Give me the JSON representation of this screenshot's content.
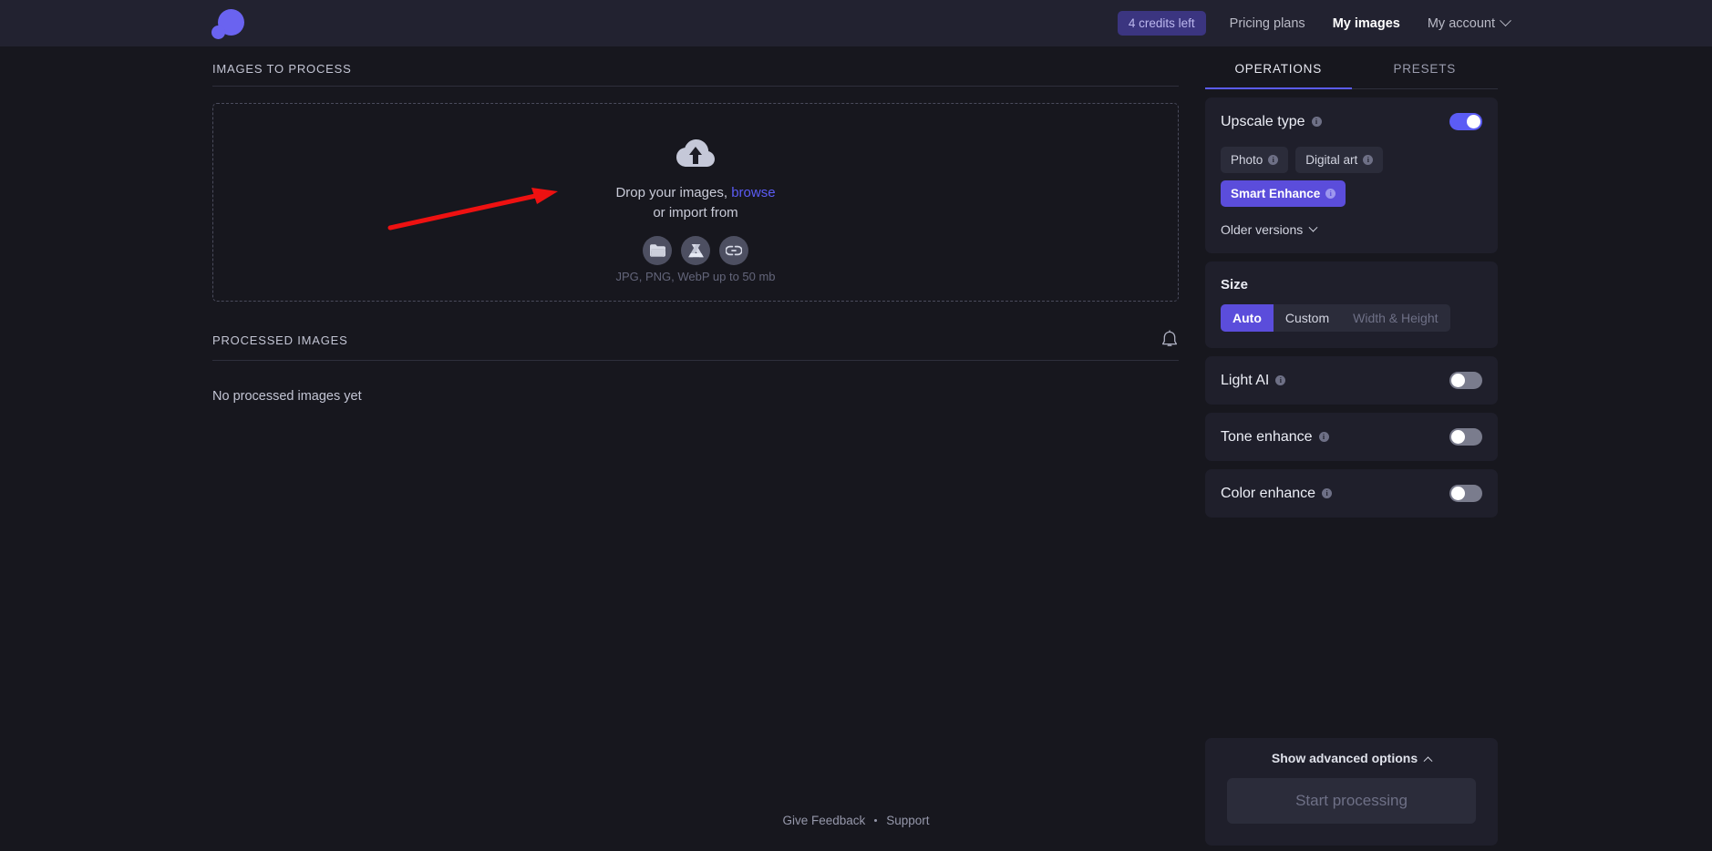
{
  "header": {
    "logo_name": "upscaler-logo",
    "credits_badge": "4 credits left",
    "nav": [
      {
        "label": "Pricing plans",
        "active": false
      },
      {
        "label": "My images",
        "active": true
      },
      {
        "label": "My account",
        "active": false
      }
    ]
  },
  "main": {
    "images_to_process_title": "IMAGES TO PROCESS",
    "dropzone": {
      "line1_prefix": "Drop your images,",
      "browse_label": "browse",
      "line2": "or import from",
      "import_buttons": [
        "folder-icon",
        "google-drive-icon",
        "link-icon"
      ],
      "file_note": "JPG, PNG, WebP up to 50 mb"
    },
    "processed_images_title": "PROCESSED IMAGES",
    "empty_state": "No processed images yet"
  },
  "panel": {
    "tabs": [
      {
        "label": "OPERATIONS",
        "active": true
      },
      {
        "label": "PRESETS",
        "active": false
      }
    ],
    "upscale": {
      "label": "Upscale type",
      "enabled": true,
      "chips": [
        {
          "label": "Photo",
          "selected": false
        },
        {
          "label": "Digital art",
          "selected": false
        },
        {
          "label": "Smart Enhance",
          "selected": true
        }
      ],
      "older_versions": "Older versions"
    },
    "size": {
      "label": "Size",
      "options": [
        {
          "label": "Auto",
          "active": true,
          "muted": false
        },
        {
          "label": "Custom",
          "active": false,
          "muted": false
        },
        {
          "label": "Width & Height",
          "active": false,
          "muted": true
        }
      ]
    },
    "toggles": [
      {
        "label": "Light AI",
        "enabled": false
      },
      {
        "label": "Tone enhance",
        "enabled": false
      },
      {
        "label": "Color enhance",
        "enabled": false
      }
    ],
    "advanced_label": "Show advanced options",
    "start_button": "Start processing"
  },
  "footer": {
    "give_feedback": "Give Feedback",
    "support": "Support"
  },
  "colors": {
    "accent": "#5b5cf5",
    "accent_chip": "#5b4ddb",
    "page_bg": "#17171e",
    "header_bg": "#222230",
    "card_bg": "#1f1f2b",
    "annotation_arrow": "#ee1111"
  }
}
